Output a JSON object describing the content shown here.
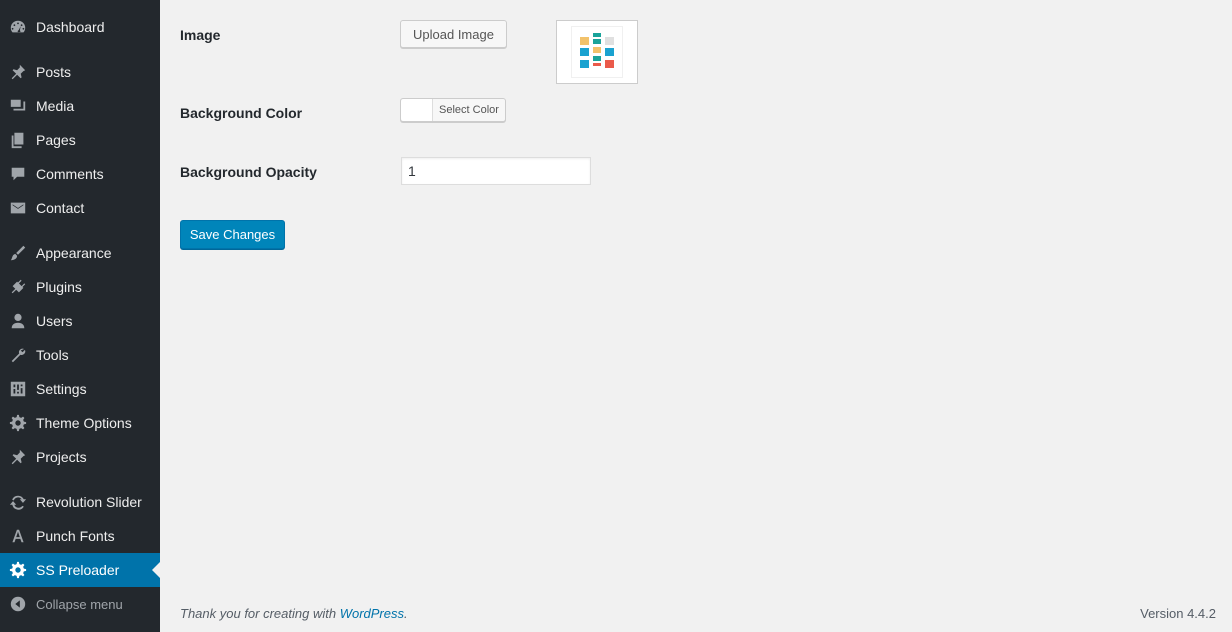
{
  "sidebar": {
    "items": [
      {
        "label": "Dashboard",
        "icon": "dashboard-icon"
      },
      {
        "label": "Posts",
        "icon": "pin-icon"
      },
      {
        "label": "Media",
        "icon": "media-icon"
      },
      {
        "label": "Pages",
        "icon": "pages-icon"
      },
      {
        "label": "Comments",
        "icon": "comment-icon"
      },
      {
        "label": "Contact",
        "icon": "mail-icon"
      },
      {
        "label": "Appearance",
        "icon": "brush-icon"
      },
      {
        "label": "Plugins",
        "icon": "plug-icon"
      },
      {
        "label": "Users",
        "icon": "user-icon"
      },
      {
        "label": "Tools",
        "icon": "wrench-icon"
      },
      {
        "label": "Settings",
        "icon": "settings-icon"
      },
      {
        "label": "Theme Options",
        "icon": "gear-icon"
      },
      {
        "label": "Projects",
        "icon": "pin-icon"
      },
      {
        "label": "Revolution Slider",
        "icon": "refresh-icon"
      },
      {
        "label": "Punch Fonts",
        "icon": "font-icon"
      },
      {
        "label": "SS Preloader",
        "icon": "gear-icon",
        "active": true
      }
    ],
    "collapse_label": "Collapse menu"
  },
  "form": {
    "image_label": "Image",
    "upload_button": "Upload Image",
    "bg_color_label": "Background Color",
    "select_color_button": "Select Color",
    "bg_color_value": "#ffffff",
    "bg_opacity_label": "Background Opacity",
    "bg_opacity_value": "1",
    "save_button": "Save Changes"
  },
  "footer": {
    "thanks_prefix": "Thank you for creating with ",
    "thanks_link": "WordPress",
    "thanks_suffix": ".",
    "version": "Version 4.4.2"
  },
  "colors": {
    "sidebar_bg": "#23282d",
    "accent": "#0073aa",
    "primary_button": "#0085ba"
  }
}
